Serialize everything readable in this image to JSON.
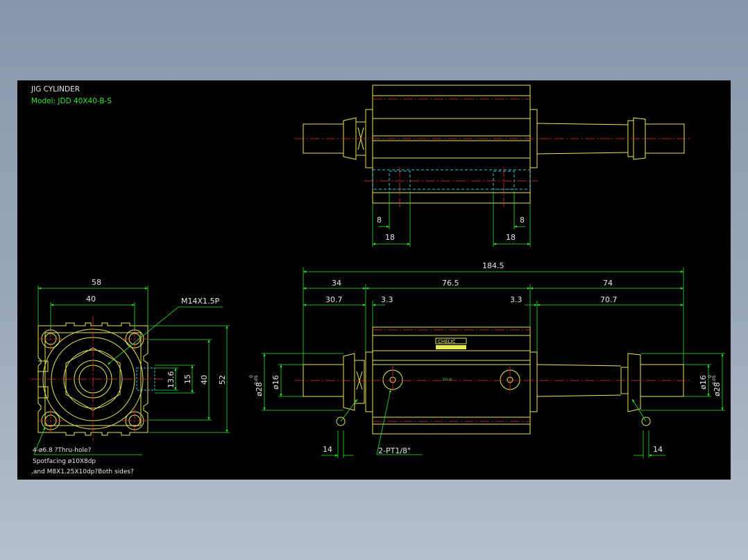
{
  "title": "JIG CYLINDER",
  "model": "Model: JDD 40X40-B-S",
  "colors": {
    "background": "#000000",
    "part": "#e8e85a",
    "dimension": "#2ee82e",
    "centerline": "#e83030",
    "hidden": "#30c8d8",
    "frame": "#9aa6b8"
  },
  "top_view": {
    "dims": {
      "left_8": "8",
      "left_18": "18",
      "right_8": "8",
      "right_18": "18"
    }
  },
  "end_view": {
    "dims": {
      "w58": "58",
      "w40": "40",
      "h13_6": "13.6",
      "h15": "15",
      "h40": "40",
      "h52": "52"
    },
    "thread_label": "M14X1.5P",
    "hole_note": [
      "4-ø6.8 ?Thru-hole?",
      "Spotfacing ø10X8dp",
      ",and M8X1.25X10dp?Both sides?"
    ]
  },
  "front_view": {
    "dims": {
      "overall": "184.5",
      "d34": "34",
      "d76_5": "76.5",
      "d74": "74",
      "d30_7": "30.7",
      "d3_3_left": "3.3",
      "d3_3_right": "3.3",
      "d70_7": "70.7",
      "dia28_left": "ø28",
      "dia16_left": "ø16",
      "dia16_right": "ø16",
      "dia28_right": "ø28",
      "tol_upper": "0",
      "tol_lower": "-0.05",
      "d14_left": "14",
      "d14_right": "14"
    },
    "port_label": "2-PT1/8\"",
    "logo": "CHELIC",
    "body_mark": "JDD 40"
  }
}
